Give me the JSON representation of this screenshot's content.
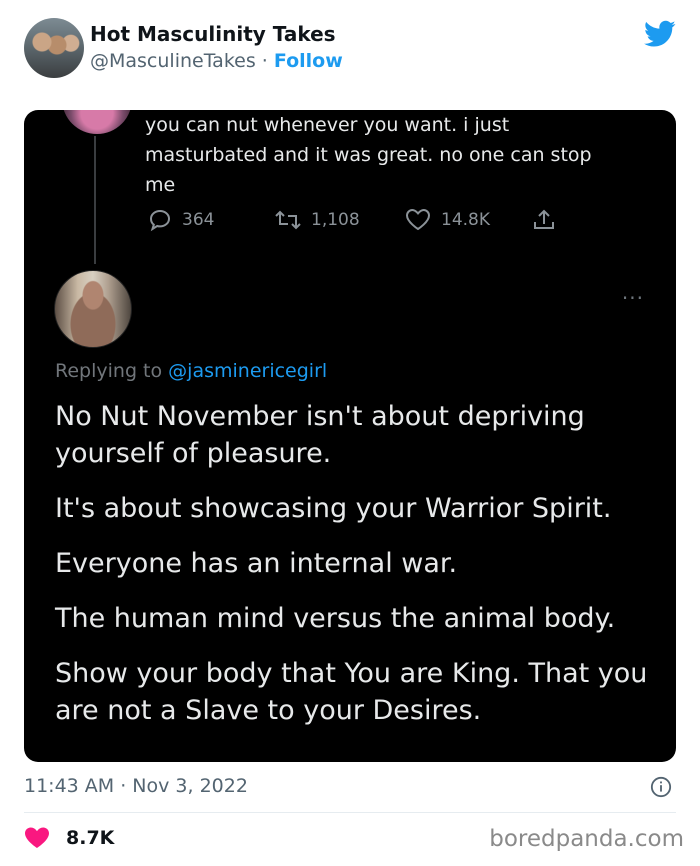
{
  "header": {
    "account_name": "Hot Masculinity Takes",
    "handle": "@MasculineTakes",
    "separator": "·",
    "follow_label": "Follow"
  },
  "embedded_screenshot": {
    "previous_tweet": {
      "text_lines": [
        "you can nut whenever you want. i just",
        "masturbated and it was great. no one can stop",
        "me"
      ],
      "replies": "364",
      "retweets": "1,108",
      "likes": "14.8K"
    },
    "reply": {
      "more_icon": "···",
      "replying_prefix": "Replying to",
      "replying_to": "@jasminericegirl",
      "paragraphs": [
        "No Nut November isn't about depriving yourself of pleasure.",
        "It's about showcasing your Warrior Spirit.",
        "Everyone has an internal war.",
        "The human mind versus the animal body.",
        "Show your body that You are King. That you are not a Slave to your Desires."
      ]
    }
  },
  "footer": {
    "timestamp": "11:43 AM · Nov 3, 2022",
    "like_count": "8.7K",
    "watermark": "boredpanda.com"
  },
  "icons": {
    "twitter_bird": "twitter-bird-icon",
    "reply": "reply-icon",
    "retweet": "retweet-icon",
    "like": "heart-icon",
    "share": "share-icon",
    "info": "info-icon"
  },
  "colors": {
    "twitter_blue": "#1d9bf0",
    "heart_red": "#f91880",
    "dark_bg": "#000000"
  }
}
